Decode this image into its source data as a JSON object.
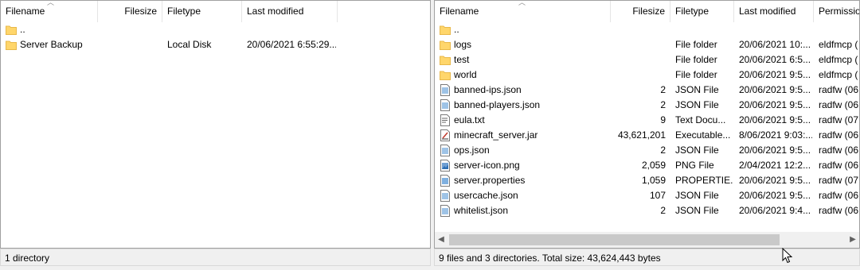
{
  "left": {
    "columns": {
      "filename": "Filename",
      "filesize": "Filesize",
      "filetype": "Filetype",
      "last_modified": "Last modified"
    },
    "rows": [
      {
        "name": "..",
        "size": "",
        "type": "",
        "modified": "",
        "icon": "folder-icon"
      },
      {
        "name": "Server Backup",
        "size": "",
        "type": "Local Disk",
        "modified": "20/06/2021 6:55:29...",
        "icon": "folder-icon"
      }
    ],
    "status": "1 directory"
  },
  "right": {
    "columns": {
      "filename": "Filename",
      "filesize": "Filesize",
      "filetype": "Filetype",
      "last_modified": "Last modified",
      "permissions": "Permissio"
    },
    "rows": [
      {
        "name": "..",
        "size": "",
        "type": "",
        "modified": "",
        "perms": "",
        "icon": "folder-icon"
      },
      {
        "name": "logs",
        "size": "",
        "type": "File folder",
        "modified": "20/06/2021 10:...",
        "perms": "eldfmcp (",
        "icon": "folder-icon"
      },
      {
        "name": "test",
        "size": "",
        "type": "File folder",
        "modified": "20/06/2021 6:5...",
        "perms": "eldfmcp (",
        "icon": "folder-icon"
      },
      {
        "name": "world",
        "size": "",
        "type": "File folder",
        "modified": "20/06/2021 9:5...",
        "perms": "eldfmcp (",
        "icon": "folder-icon"
      },
      {
        "name": "banned-ips.json",
        "size": "2",
        "type": "JSON File",
        "modified": "20/06/2021 9:5...",
        "perms": "radfw (06",
        "icon": "json-file-icon"
      },
      {
        "name": "banned-players.json",
        "size": "2",
        "type": "JSON File",
        "modified": "20/06/2021 9:5...",
        "perms": "radfw (06",
        "icon": "json-file-icon"
      },
      {
        "name": "eula.txt",
        "size": "9",
        "type": "Text Docu...",
        "modified": "20/06/2021 9:5...",
        "perms": "radfw (07",
        "icon": "text-file-icon"
      },
      {
        "name": "minecraft_server.jar",
        "size": "43,621,201",
        "type": "Executable...",
        "modified": "8/06/2021 9:03:...",
        "perms": "radfw (06",
        "icon": "jar-file-icon"
      },
      {
        "name": "ops.json",
        "size": "2",
        "type": "JSON File",
        "modified": "20/06/2021 9:5...",
        "perms": "radfw (06",
        "icon": "json-file-icon"
      },
      {
        "name": "server-icon.png",
        "size": "2,059",
        "type": "PNG File",
        "modified": "2/04/2021 12:2...",
        "perms": "radfw (06",
        "icon": "image-file-icon"
      },
      {
        "name": "server.properties",
        "size": "1,059",
        "type": "PROPERTIE...",
        "modified": "20/06/2021 9:5...",
        "perms": "radfw (07",
        "icon": "properties-file-icon"
      },
      {
        "name": "usercache.json",
        "size": "107",
        "type": "JSON File",
        "modified": "20/06/2021 9:5...",
        "perms": "radfw (06",
        "icon": "json-file-icon"
      },
      {
        "name": "whitelist.json",
        "size": "2",
        "type": "JSON File",
        "modified": "20/06/2021 9:4...",
        "perms": "radfw (06",
        "icon": "json-file-icon"
      }
    ],
    "status": "9 files and 3 directories. Total size: 43,624,443 bytes"
  },
  "colors": {
    "folder": "#ffd66b",
    "folder_dark": "#e8b84a",
    "file_blue": "#9ec3e6",
    "scroll_thumb": "#c9c9c9"
  }
}
